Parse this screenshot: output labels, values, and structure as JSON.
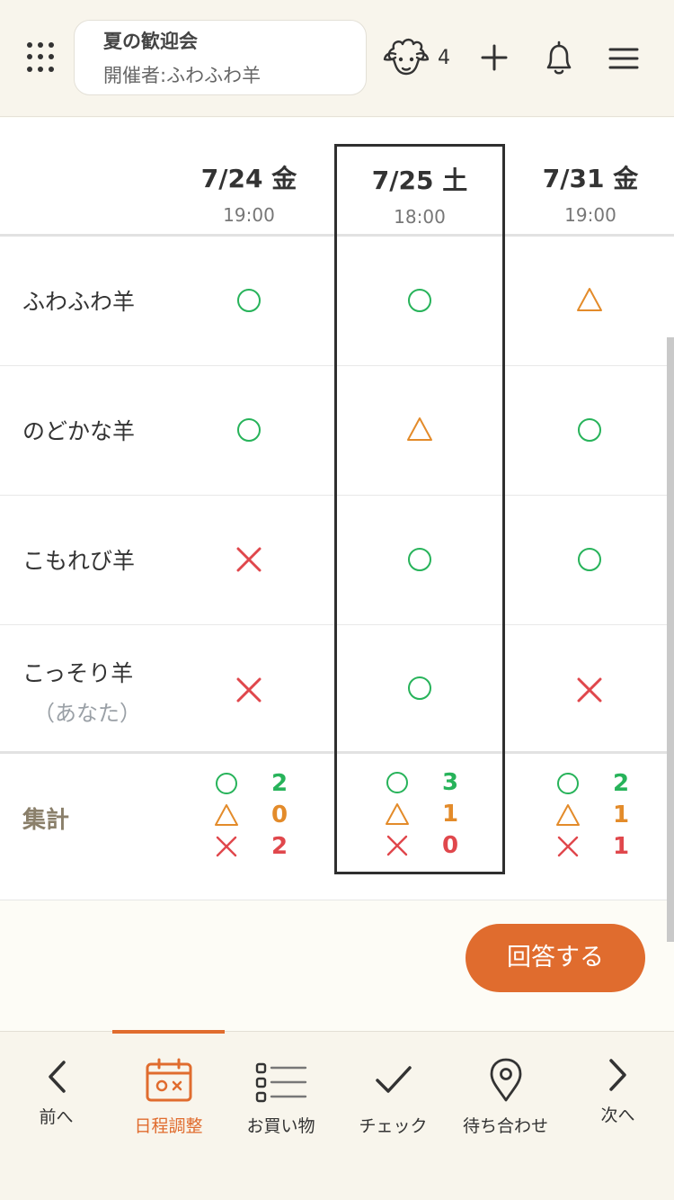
{
  "header": {
    "event_title": "夏の歓迎会",
    "event_host": "開催者:ふわふわ羊",
    "member_count": "4"
  },
  "dates": [
    {
      "date": "7/24 金",
      "time": "19:00"
    },
    {
      "date": "7/25 土",
      "time": "18:00"
    },
    {
      "date": "7/31 金",
      "time": "19:00"
    }
  ],
  "participants": [
    {
      "name": "ふわふわ羊",
      "sub": "",
      "answers": [
        "ok",
        "ok",
        "maybe"
      ]
    },
    {
      "name": "のどかな羊",
      "sub": "",
      "answers": [
        "ok",
        "maybe",
        "ok"
      ]
    },
    {
      "name": "こもれび羊",
      "sub": "",
      "answers": [
        "no",
        "ok",
        "ok"
      ]
    },
    {
      "name": "こっそり羊",
      "sub": "（あなた）",
      "answers": [
        "no",
        "ok",
        "no"
      ]
    }
  ],
  "summary": {
    "label": "集計",
    "totals": [
      {
        "ok": "2",
        "maybe": "0",
        "no": "2"
      },
      {
        "ok": "3",
        "maybe": "1",
        "no": "0"
      },
      {
        "ok": "2",
        "maybe": "1",
        "no": "1"
      }
    ]
  },
  "highlighted_date_index": 1,
  "answer_button": "回答する",
  "nav": {
    "prev": "前へ",
    "schedule": "日程調整",
    "shopping": "お買い物",
    "check": "チェック",
    "meetup": "待ち合わせ",
    "next": "次へ"
  },
  "colors": {
    "accent": "#e06c2e",
    "ok": "#27b35a",
    "maybe": "#e38b2a",
    "no": "#e0474c"
  }
}
